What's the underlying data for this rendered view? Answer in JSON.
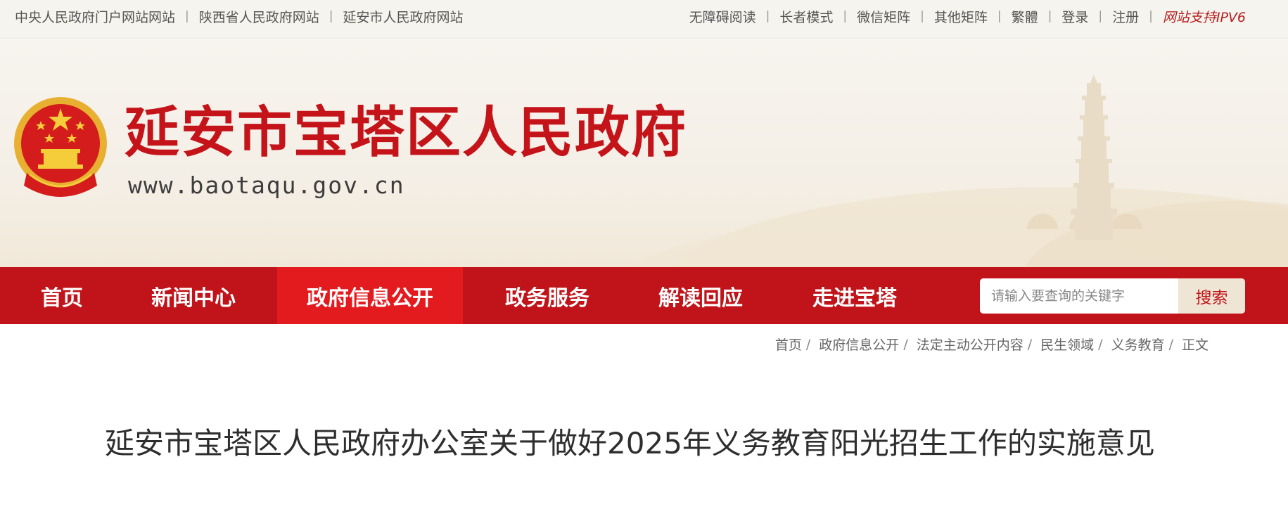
{
  "topbar": {
    "left_links": [
      "中央人民政府门户网站网站",
      "陕西省人民政府网站",
      "延安市人民政府网站"
    ],
    "right_links": [
      "无障碍阅读",
      "长者模式",
      "微信矩阵",
      "其他矩阵",
      "繁體",
      "登录",
      "注册"
    ],
    "ipv6_label": "网站支持IPV6",
    "separator": "|"
  },
  "header": {
    "site_title": "延安市宝塔区人民政府",
    "site_url": "www.baotaqu.gov.cn"
  },
  "nav": {
    "items": [
      {
        "label": "首页",
        "active": false
      },
      {
        "label": "新闻中心",
        "active": false
      },
      {
        "label": "政府信息公开",
        "active": true
      },
      {
        "label": "政务服务",
        "active": false
      },
      {
        "label": "解读回应",
        "active": false
      },
      {
        "label": "走进宝塔",
        "active": false
      }
    ]
  },
  "search": {
    "placeholder": "请输入要查询的关键字",
    "button_label": "搜索"
  },
  "breadcrumb": {
    "items": [
      "首页",
      "政府信息公开",
      "法定主动公开内容",
      "民生领域",
      "义务教育",
      "正文"
    ]
  },
  "article": {
    "title": "延安市宝塔区人民政府办公室关于做好2025年义务教育阳光招生工作的实施意见"
  },
  "colors": {
    "brand_red": "#c0141a",
    "active_red": "#e31a1e",
    "topbar_bg": "#f6f4ef",
    "search_button_bg": "#efe5d4"
  }
}
